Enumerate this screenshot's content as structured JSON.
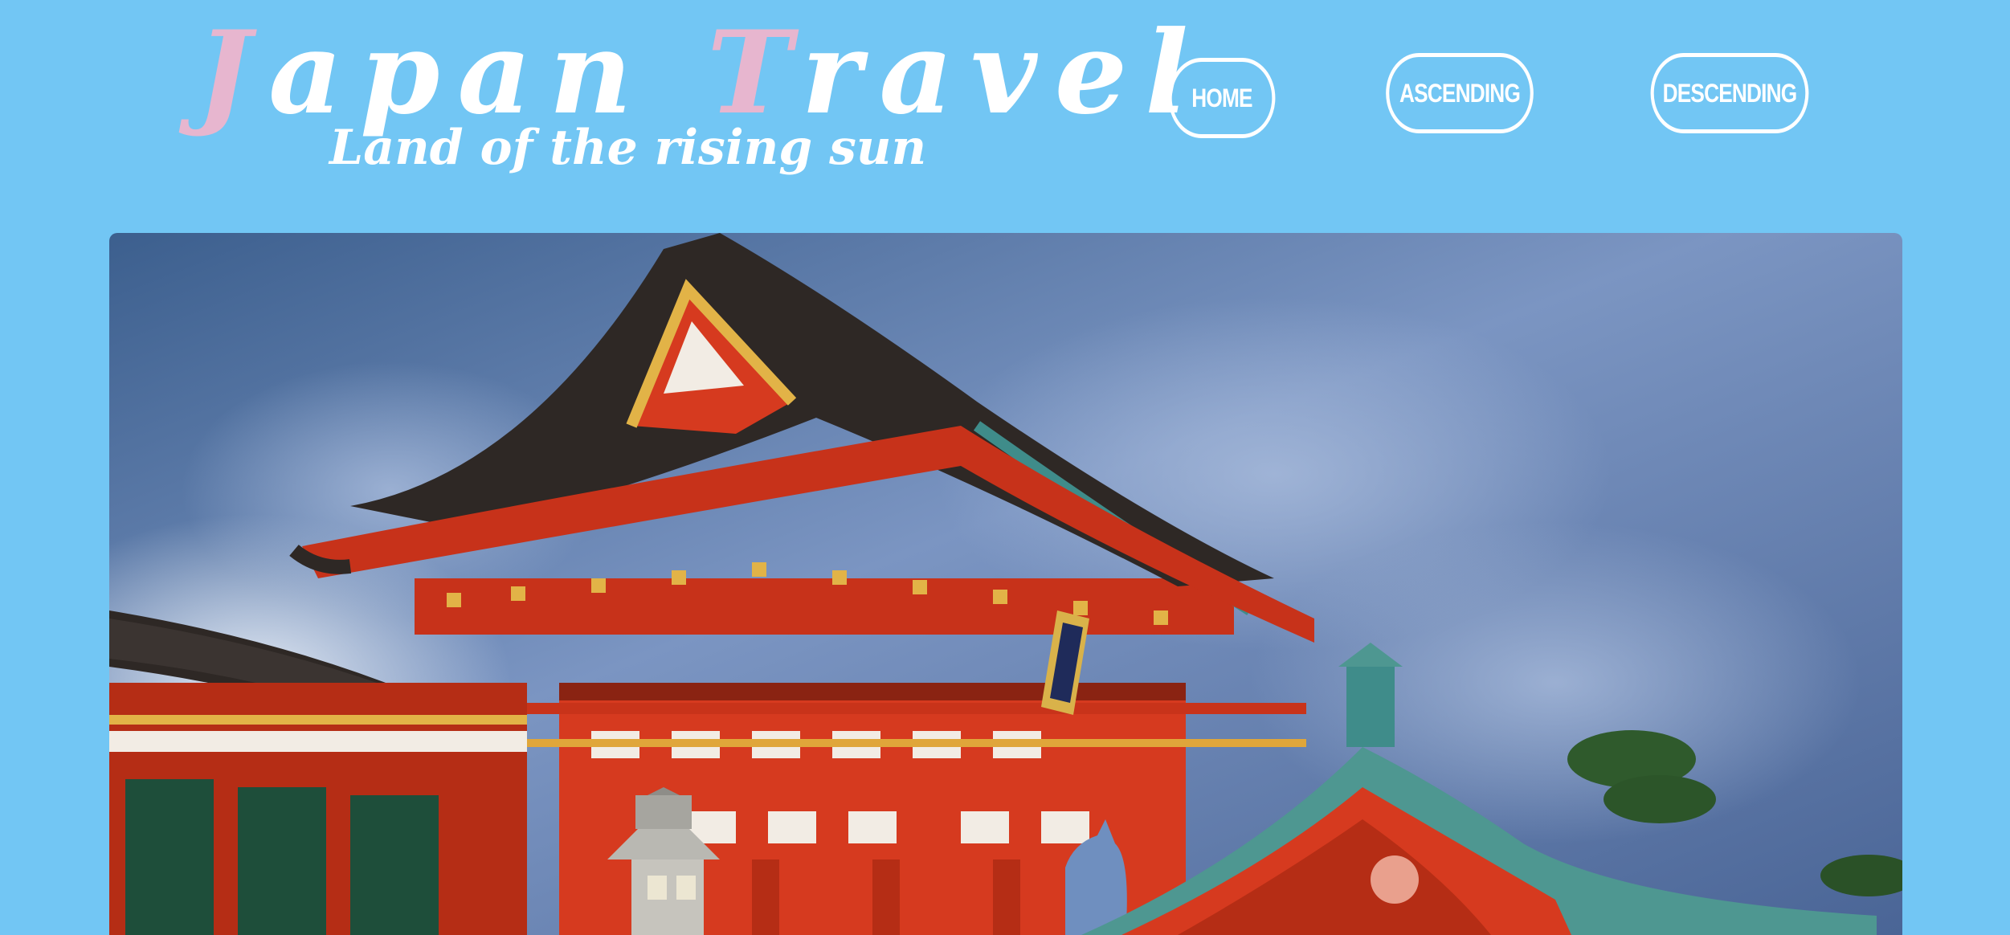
{
  "header": {
    "title_j": "J",
    "title_apan": "apan ",
    "title_t": "T",
    "title_ravel": "ravel",
    "subtitle": "Land of the rising sun",
    "title_accent_color": "#e7b6cf"
  },
  "nav": {
    "home": "HOME",
    "ascending": "ASCENDING",
    "descending": "DESCENDING"
  },
  "hero": {
    "subject": "red-shrine-gate-photo"
  },
  "colors": {
    "background": "#72c6f4",
    "sky": "#4f6ea0",
    "shrine_red": "#d63a1f",
    "roof_dark": "#2e2825",
    "roof_green": "#3f8c8a"
  }
}
